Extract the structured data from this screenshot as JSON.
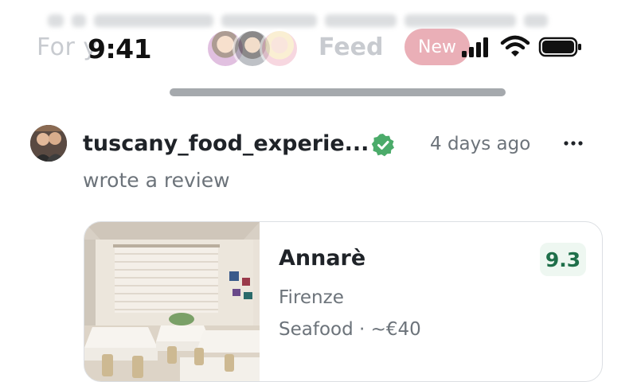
{
  "status_bar": {
    "time": "9:41",
    "icons": [
      "signal-icon",
      "wifi-icon",
      "battery-icon"
    ]
  },
  "tabs": {
    "for_you": "For y",
    "feed": "Feed",
    "new_badge": "New"
  },
  "post": {
    "username": "tuscany_food_experie...",
    "verified": true,
    "timestamp": "4 days ago",
    "action": "wrote a review",
    "more_icon": "more-horizontal-icon"
  },
  "review_card": {
    "name": "Annarè",
    "city": "Firenze",
    "meta": "Seafood · ~€40",
    "score": "9.3"
  },
  "colors": {
    "verified_green": "#4bab6a",
    "score_green": "#1f6f4a",
    "new_pill_pink": "#e8a7b0"
  }
}
